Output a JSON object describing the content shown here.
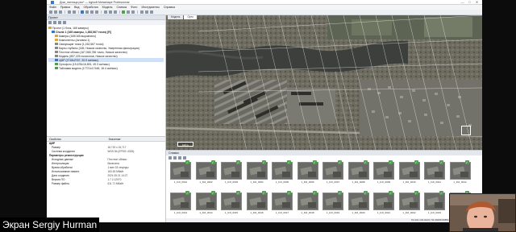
{
  "window": {
    "title": "Дом_пятница.psx* — Agisoft Metashape Professional",
    "controls": [
      "—",
      "□",
      "✕"
    ]
  },
  "menu": [
    "Файл",
    "Правка",
    "Вид",
    "Обработка",
    "Модель",
    "Снимок",
    "Фото",
    "Инструменты",
    "Справка"
  ],
  "workspace": {
    "title": "Проект",
    "items": [
      {
        "label": "Проект (1 блок, 165 камеры)",
        "level": 0,
        "icon": "folder",
        "color": "#d9a43a"
      },
      {
        "label": "Chunk 1 (165 камеры, 1,852,567 точек) [R]",
        "level": 1,
        "icon": "chunk",
        "color": "#3b74c4",
        "bold": true
      },
      {
        "label": "Камеры (165/165 выровнено)",
        "level": 2,
        "icon": "camera",
        "color": "#e0a73b"
      },
      {
        "label": "Компоненты (Активно:1)",
        "level": 2,
        "icon": "component",
        "color": "#e0a73b"
      },
      {
        "label": "Связующие точки (1,262,567 точек)",
        "level": 2,
        "icon": "points",
        "color": "#888888"
      },
      {
        "label": "Карты глубины (165, Низкое качество, Умеренная фильтрация)",
        "level": 2,
        "icon": "depth",
        "color": "#888888"
      },
      {
        "label": "Плотное облако (167,565,786 точек, Низкое качество)",
        "level": 2,
        "icon": "cloud",
        "color": "#888888"
      },
      {
        "label": "Модель (857,225 полигонов, Низкое качество)",
        "level": 2,
        "icon": "model",
        "color": "#888888"
      },
      {
        "label": "ЦМР (2718x2767, 20.9 см/пикс)",
        "level": 2,
        "icon": "dem",
        "color": "#3b74c4",
        "selected": true
      },
      {
        "label": "Ортофото (19,678x16,891, 49.3 см/пикс)",
        "level": 2,
        "icon": "ortho",
        "color": "#4aa24a"
      },
      {
        "label": "Тайловая модель (17721x17448, 18.4 см/пикс)",
        "level": 2,
        "icon": "tiled",
        "color": "#4aa24a"
      }
    ]
  },
  "map": {
    "tabs": [
      "Модель",
      "Орто"
    ],
    "active_tab": "Орто",
    "scale_label": "100 m"
  },
  "properties": {
    "headers": [
      "Свойство",
      "Значение"
    ],
    "rows": [
      {
        "k": "ЦМР",
        "v": "",
        "type": "grp"
      },
      {
        "k": "Размер",
        "v": "18,720 x 15,717",
        "type": "sub"
      },
      {
        "k": "Система координат",
        "v": "WGS 84 (EPSG::4326)",
        "type": "sub"
      },
      {
        "k": "Параметры реконструкции",
        "v": "",
        "type": "grp"
      },
      {
        "k": "Исходные данные",
        "v": "Плотное облако",
        "type": "sub"
      },
      {
        "k": "Интерполяция",
        "v": "Включено",
        "type": "sub"
      },
      {
        "k": "Время обработки",
        "v": "1 мин 18 секунды",
        "type": "sub"
      },
      {
        "k": "Использование памяти",
        "v": "163.63 Мбайт",
        "type": "sub"
      },
      {
        "k": "Дата создания",
        "v": "2021.05.21 14:27",
        "type": "sub"
      },
      {
        "k": "Версия ПО",
        "v": "1.7.2.12070",
        "type": "sub"
      },
      {
        "k": "Размер файла",
        "v": "611.71 Мбайт",
        "type": "sub"
      }
    ]
  },
  "photos": {
    "title": "Снимки",
    "row1": [
      "1_DJI_0001",
      "1_DJI_0002",
      "1_DJI_0003",
      "1_DJI_0004",
      "1_DJI_0005",
      "1_DJI_0006",
      "1_DJI_0007",
      "1_DJI_0008",
      "1_DJI_0009",
      "1_DJI_0010",
      "1_DJI_0011",
      "1_DJI_0012"
    ],
    "row2": [
      "1_DJI_0013",
      "1_DJI_0014",
      "1_DJI_0015",
      "1_DJI_0016",
      "1_DJI_0017",
      "1_DJI_0018",
      "1_DJI_0019",
      "1_DJI_0020",
      "1_DJI_0021",
      "1_DJI_0022",
      "1_DJI_0023",
      "1_DJI_0024"
    ],
    "status": "54.431 134.9123 | 54.36068.69851 | 50.2 м"
  },
  "caption": "Экран Sergiy Hurman"
}
